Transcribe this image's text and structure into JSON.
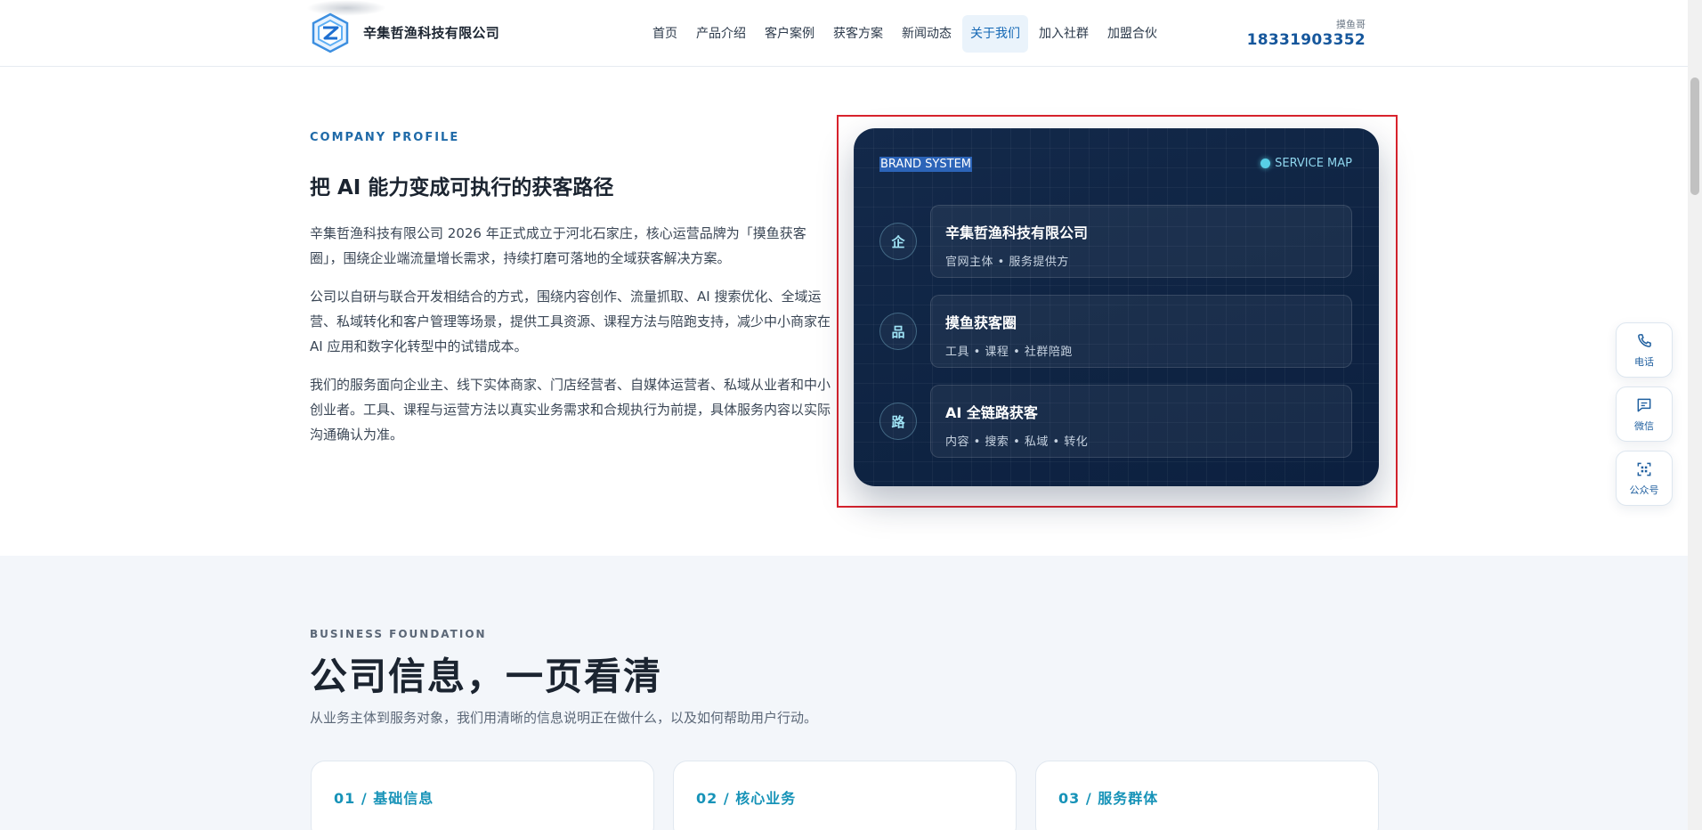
{
  "header": {
    "brand_name": "辛集哲渔科技有限公司",
    "nav": [
      "首页",
      "产品介绍",
      "客户案例",
      "获客方案",
      "新闻动态",
      "关于我们",
      "加入社群",
      "加盟合伙"
    ],
    "active_nav": "关于我们",
    "contact_label": "摸鱼哥",
    "contact_phone": "18331903352"
  },
  "profile": {
    "eyebrow": "COMPANY PROFILE",
    "title": "把 AI 能力变成可执行的获客路径",
    "paragraphs": [
      "辛集哲渔科技有限公司 2026 年正式成立于河北石家庄，核心运营品牌为「摸鱼获客圈」，围绕企业端流量增长需求，持续打磨可落地的全域获客解决方案。",
      "公司以自研与联合开发相结合的方式，围绕内容创作、流量抓取、AI 搜索优化、全域运营、私域转化和客户管理等场景，提供工具资源、课程方法与陪跑支持，减少中小商家在 AI 应用和数字化转型中的试错成本。",
      "我们的服务面向企业主、线下实体商家、门店经营者、自媒体运营者、私域从业者和中小创业者。工具、课程与运营方法以真实业务需求和合规执行为前提，具体服务内容以实际沟通确认为准。"
    ]
  },
  "brand_card": {
    "tag": "BRAND SYSTEM",
    "map_label": "SERVICE MAP",
    "rows": [
      {
        "badge": "企",
        "title": "辛集哲渔科技有限公司",
        "sub": "官网主体 • 服务提供方"
      },
      {
        "badge": "品",
        "title": "摸鱼获客圈",
        "sub": "工具 • 课程 • 社群陪跑"
      },
      {
        "badge": "路",
        "title": "AI 全链路获客",
        "sub": "内容 • 搜索 • 私域 • 转化"
      }
    ]
  },
  "floating": {
    "phone": "电话",
    "wechat": "微信",
    "official": "公众号"
  },
  "foundation": {
    "eyebrow": "BUSINESS FOUNDATION",
    "title": "公司信息，一页看清",
    "desc": "从业务主体到服务对象，我们用清晰的信息说明正在做什么，以及如何帮助用户行动。",
    "cards": [
      "01 / 基础信息",
      "02 / 核心业务",
      "03 / 服务群体"
    ]
  },
  "colors": {
    "brand_blue": "#16579c",
    "accent_cyan": "#1793b8",
    "card_navy": "#0f2443",
    "highlight_red": "#d9232d"
  }
}
